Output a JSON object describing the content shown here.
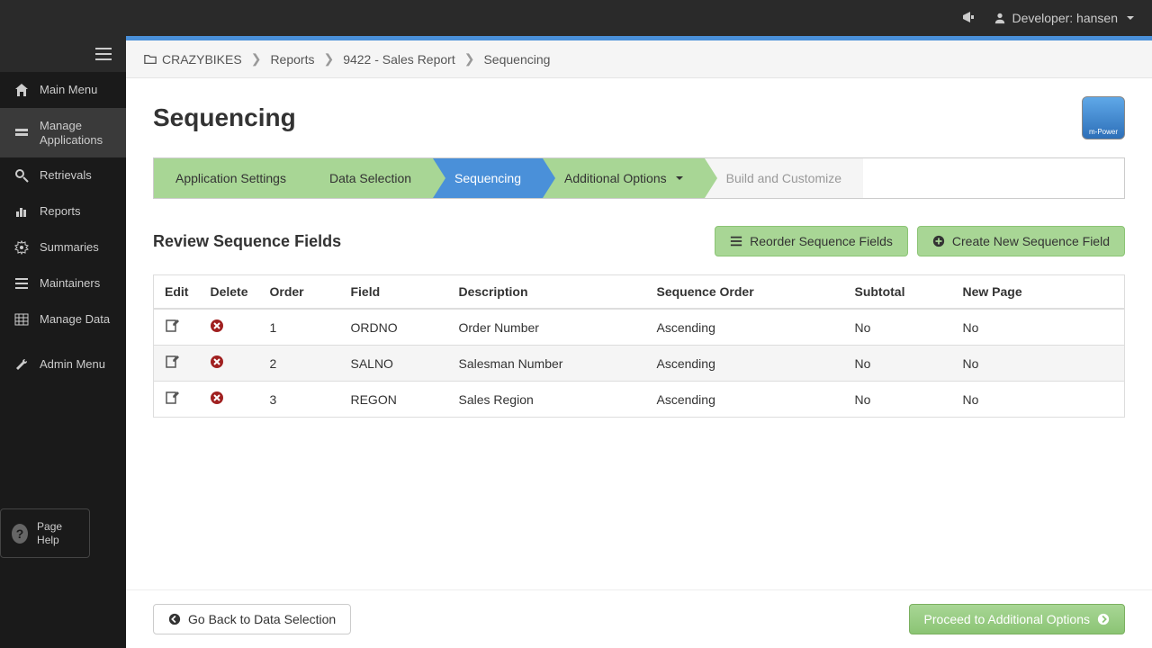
{
  "topbar": {
    "user_label": "Developer: hansen"
  },
  "sidebar": {
    "items": [
      {
        "label": "Main Menu"
      },
      {
        "label": "Manage Applications"
      },
      {
        "label": "Retrievals"
      },
      {
        "label": "Reports"
      },
      {
        "label": "Summaries"
      },
      {
        "label": "Maintainers"
      },
      {
        "label": "Manage Data"
      },
      {
        "label": "Admin Menu"
      }
    ],
    "page_help": "Page Help"
  },
  "breadcrumb": {
    "items": [
      "CRAZYBIKES",
      "Reports",
      "9422 - Sales Report",
      "Sequencing"
    ]
  },
  "page": {
    "title": "Sequencing",
    "logo": "m-Power"
  },
  "wizard": {
    "steps": [
      {
        "label": "Application Settings"
      },
      {
        "label": "Data Selection"
      },
      {
        "label": "Sequencing"
      },
      {
        "label": "Additional Options"
      },
      {
        "label": "Build and Customize"
      }
    ]
  },
  "section": {
    "title": "Review Sequence Fields",
    "reorder_btn": "Reorder Sequence Fields",
    "create_btn": "Create New Sequence Field"
  },
  "table": {
    "headers": [
      "Edit",
      "Delete",
      "Order",
      "Field",
      "Description",
      "Sequence Order",
      "Subtotal",
      "New Page"
    ],
    "rows": [
      {
        "order": "1",
        "field": "ORDNO",
        "description": "Order Number",
        "sequence_order": "Ascending",
        "subtotal": "No",
        "new_page": "No"
      },
      {
        "order": "2",
        "field": "SALNO",
        "description": "Salesman Number",
        "sequence_order": "Ascending",
        "subtotal": "No",
        "new_page": "No"
      },
      {
        "order": "3",
        "field": "REGON",
        "description": "Sales Region",
        "sequence_order": "Ascending",
        "subtotal": "No",
        "new_page": "No"
      }
    ]
  },
  "footer": {
    "back_btn": "Go Back to Data Selection",
    "proceed_btn": "Proceed to Additional Options"
  }
}
